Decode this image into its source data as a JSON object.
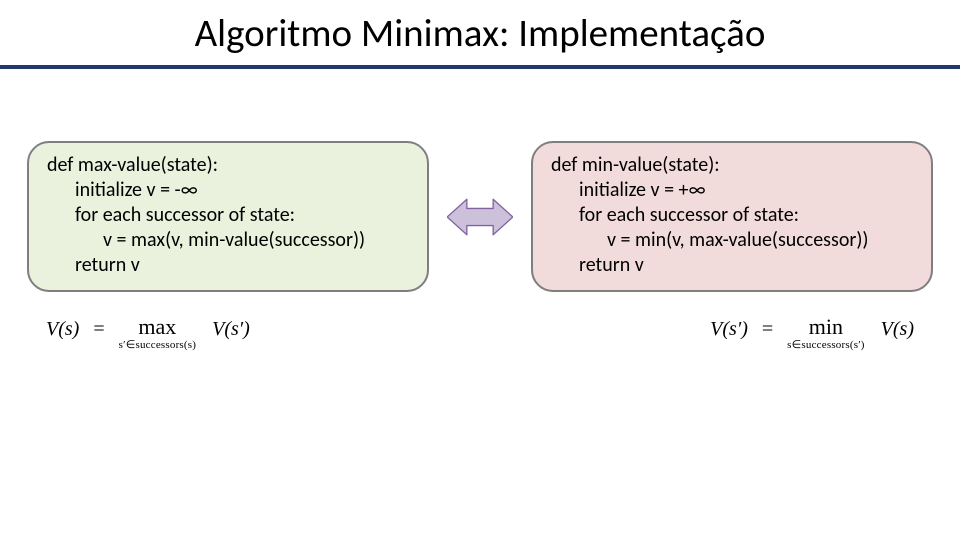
{
  "title": "Algoritmo Minimax: Implementação",
  "left": {
    "l1": "def max-value(state):",
    "l2": "initialize v = -∞",
    "l3": "for each successor of state:",
    "l4": "v = max(v, min-value(successor))",
    "l5": "return v"
  },
  "right": {
    "l1": "def min-value(state):",
    "l2": "initialize v = +∞",
    "l3": "for each successor of state:",
    "l4": "v = min(v, max-value(successor))",
    "l5": "return v"
  },
  "formula_left": {
    "lhs": "V(s)",
    "eq": "=",
    "op": "max",
    "sub": "s′∈successors(s)",
    "rhs": "V(s′)"
  },
  "formula_right": {
    "lhs": "V(s′)",
    "eq": "=",
    "op": "min",
    "sub": "s∈successors(s′)",
    "rhs": "V(s)"
  },
  "colors": {
    "rule": "#1f3a6e",
    "left_bg": "#eaf1dd",
    "right_bg": "#f2dcdb",
    "arrow_fill": "#ccc0da",
    "arrow_stroke": "#8064a2"
  }
}
